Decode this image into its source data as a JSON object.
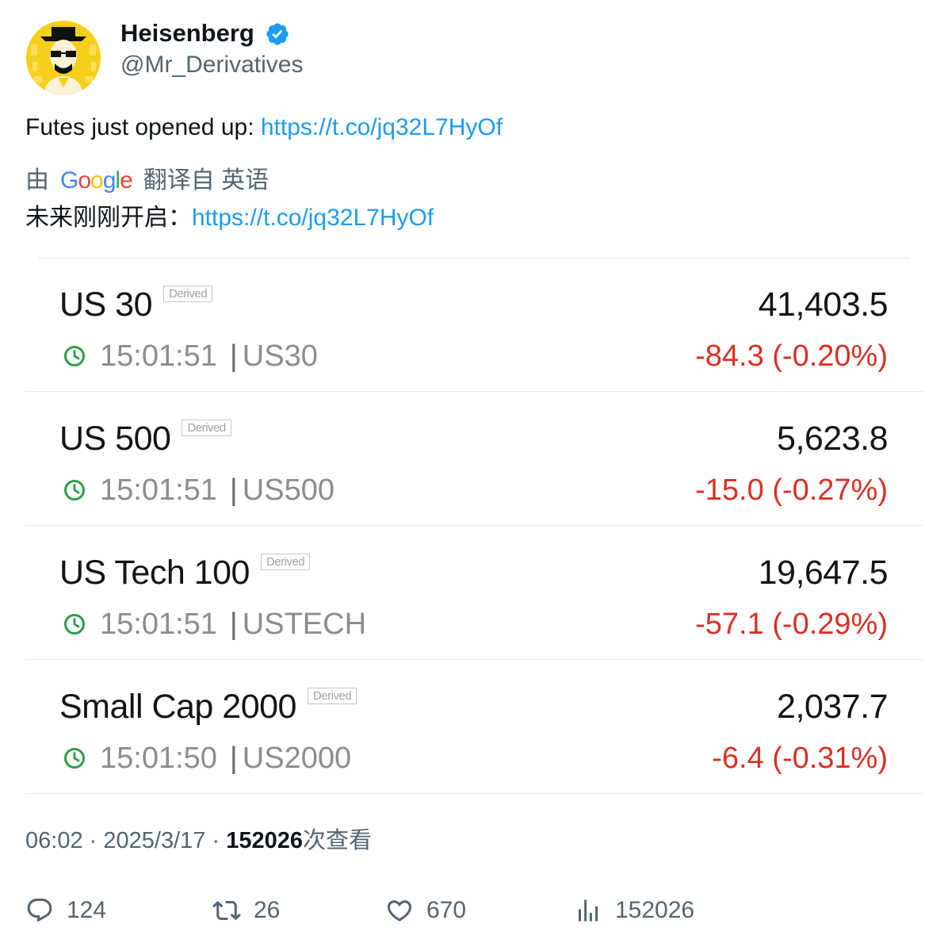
{
  "author": {
    "display_name": "Heisenberg",
    "handle": "@Mr_Derivatives",
    "verified": true
  },
  "tweet": {
    "text": "Futes just opened up: ",
    "link": "https://t.co/jq32L7HyOf"
  },
  "translation": {
    "prefix": "由",
    "provider": "Google",
    "suffix": "翻译自 英语",
    "text": "未来刚刚开启：",
    "link": "https://t.co/jq32L7HyOf"
  },
  "quotes": [
    {
      "name": "US 30",
      "badge": "Derived",
      "price": "41,403.5",
      "time": "15:01:51",
      "sep": "|",
      "symbol": "US30",
      "change": "-84.3 (-0.20%)"
    },
    {
      "name": "US 500",
      "badge": "Derived",
      "price": "5,623.8",
      "time": "15:01:51",
      "sep": "|",
      "symbol": "US500",
      "change": "-15.0 (-0.27%)"
    },
    {
      "name": "US Tech 100",
      "badge": "Derived",
      "price": "19,647.5",
      "time": "15:01:51",
      "sep": "|",
      "symbol": "USTECH",
      "change": "-57.1 (-0.29%)"
    },
    {
      "name": "Small Cap 2000",
      "badge": "Derived",
      "price": "2,037.7",
      "time": "15:01:50",
      "sep": "|",
      "symbol": "US2000",
      "change": "-6.4 (-0.31%)"
    }
  ],
  "meta": {
    "time": "06:02",
    "dot": "·",
    "date": "2025/3/17",
    "views": "152026",
    "views_label": "次查看"
  },
  "actions": {
    "replies": "124",
    "retweets": "26",
    "likes": "670",
    "views": "152026"
  },
  "colors": {
    "link": "#1d9bf0",
    "verified": "#1d9bf0",
    "negative": "#d93025",
    "clock": "#2e9e44",
    "muted": "#536471"
  },
  "icons": [
    "verified-badge-icon",
    "clock-icon",
    "reply-icon",
    "retweet-icon",
    "like-icon",
    "views-icon"
  ]
}
